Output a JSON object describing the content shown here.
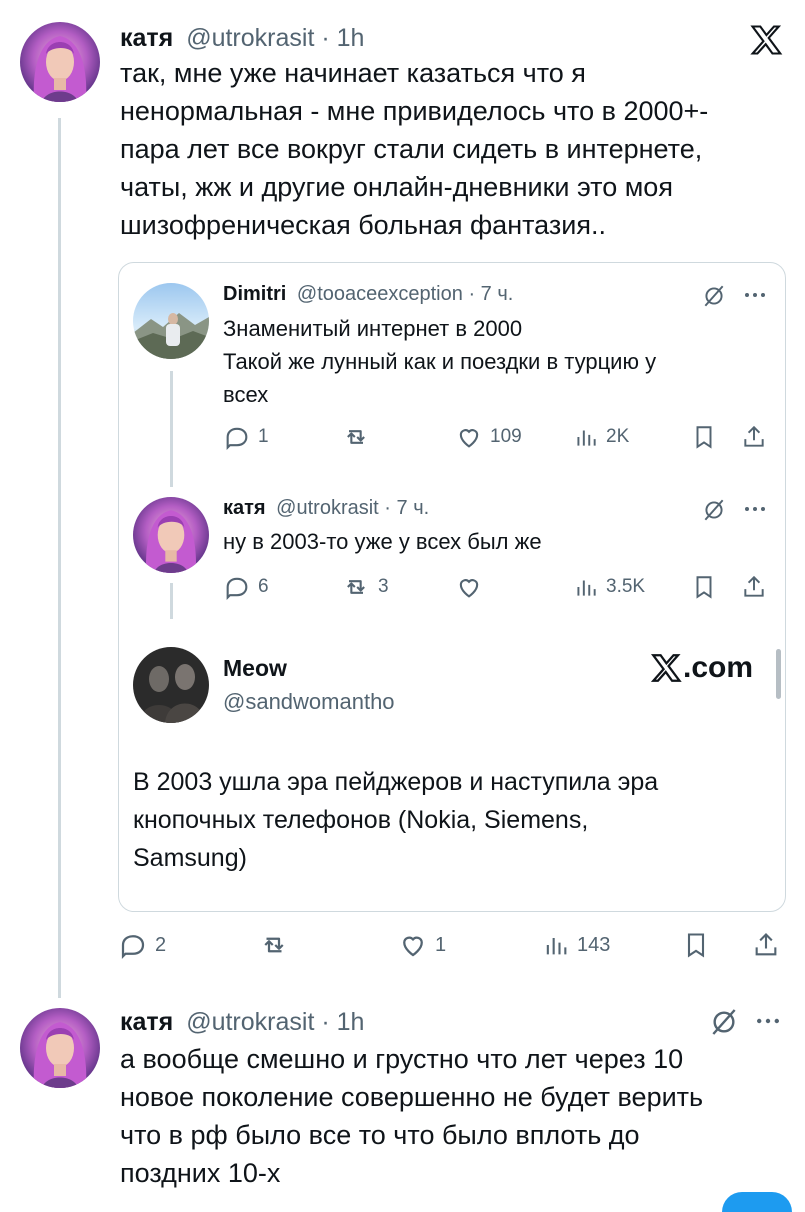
{
  "main_tweet": {
    "display_name": "катя",
    "handle": "@utrokrasit",
    "time": "1h",
    "text_lines": [
      "так, мне уже начинает казаться что я",
      "ненормальная - мне привиделось что в 2000+-",
      "пара лет все вокруг стали сидеть в интернете,",
      "чаты, жж и другие онлайн-дневники это моя",
      "шизофреническая больная фантазия.."
    ],
    "stats": {
      "replies": "2",
      "retweets": "",
      "likes": "1",
      "views": "143"
    }
  },
  "quoted": {
    "tweet1": {
      "display_name": "Dimitri",
      "handle": "@tooaceexception",
      "time": "7 ч.",
      "text_lines": [
        "Знаменитый интернет в 2000",
        "Такой же лунный как и поездки в турцию у",
        "всех"
      ],
      "stats": {
        "replies": "1",
        "retweets": "",
        "likes": "109",
        "views": "2K"
      }
    },
    "tweet2": {
      "display_name": "катя",
      "handle": "@utrokrasit",
      "time": "7 ч.",
      "text_lines": [
        "ну в 2003-то уже у всех был же"
      ],
      "stats": {
        "replies": "6",
        "retweets": "3",
        "likes": "",
        "views": "3.5K"
      }
    },
    "embed": {
      "display_name": "Meow",
      "handle": "@sandwomantho",
      "brand": ".com",
      "text_lines": [
        "В 2003 ушла эра пейджеров и наступила эра",
        "кнопочных телефонов (Nokia, Siemens,",
        "Samsung)"
      ]
    }
  },
  "second_tweet": {
    "display_name": "катя",
    "handle": "@utrokrasit",
    "time": "1h",
    "text_lines": [
      "а вообще смешно и грустно что лет через 10",
      "новое поколение совершенно не будет верить",
      "что в рф было все то что было вплоть до",
      "поздних 10-х"
    ]
  },
  "colors": {
    "text": "#0f1419",
    "muted": "#536471",
    "border": "#cfd9de",
    "accent": "#1d9bf0"
  }
}
